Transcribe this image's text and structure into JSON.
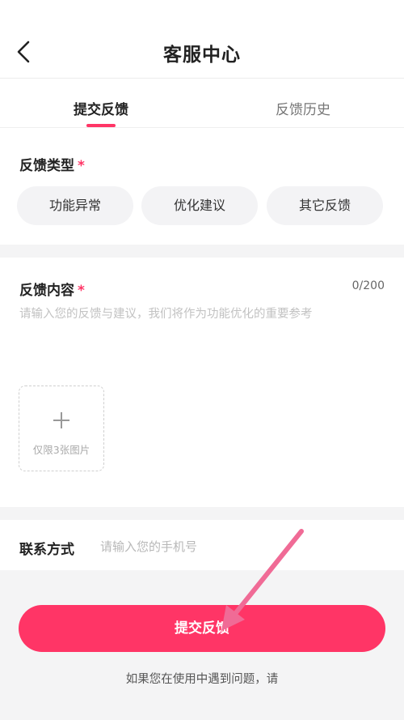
{
  "header": {
    "title": "客服中心",
    "back_icon": "chevron-left-icon"
  },
  "tabs": [
    {
      "label": "提交反馈",
      "active": true
    },
    {
      "label": "反馈历史",
      "active": false
    }
  ],
  "feedback_type": {
    "label": "反馈类型",
    "required_mark": "*",
    "options": [
      "功能异常",
      "优化建议",
      "其它反馈"
    ]
  },
  "feedback_content": {
    "label": "反馈内容",
    "required_mark": "*",
    "counter": "0/200",
    "placeholder": "请输入您的反馈与建议，我们将作为功能优化的重要参考",
    "value": "",
    "upload_icon": "plus-icon",
    "upload_hint": "仅限3张图片"
  },
  "contact": {
    "label": "联系方式",
    "placeholder": "请输入您的手机号",
    "value": ""
  },
  "submit_label": "提交反馈",
  "footer_note": "如果您在使用中遇到问题，请",
  "annotation": {
    "icon": "arrow-annotation-icon",
    "color": "#f06b96"
  },
  "colors": {
    "accent": "#ff3566",
    "background": "#f4f4f5"
  }
}
